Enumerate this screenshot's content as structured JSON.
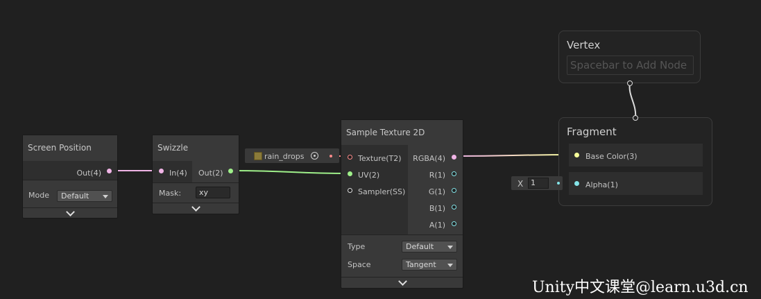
{
  "nodes": {
    "screen_position": {
      "title": "Screen Position",
      "out": "Out(4)",
      "mode_label": "Mode",
      "mode_value": "Default"
    },
    "swizzle": {
      "title": "Swizzle",
      "in": "In(4)",
      "out": "Out(2)",
      "mask_label": "Mask:",
      "mask_value": "xy"
    },
    "texture_property": {
      "value": "rain_drops"
    },
    "sample_texture": {
      "title": "Sample Texture 2D",
      "inputs": [
        "Texture(T2)",
        "UV(2)",
        "Sampler(SS)"
      ],
      "outputs": [
        "RGBA(4)",
        "R(1)",
        "G(1)",
        "B(1)",
        "A(1)"
      ],
      "type_label": "Type",
      "type_value": "Default",
      "space_label": "Space",
      "space_value": "Tangent"
    },
    "alpha_input": {
      "axis": "X",
      "value": "1"
    }
  },
  "master": {
    "vertex": {
      "title": "Vertex",
      "placeholder": "Spacebar to Add Node"
    },
    "fragment": {
      "title": "Fragment",
      "base_color": "Base Color(3)",
      "alpha": "Alpha(1)"
    }
  },
  "colors": {
    "vector4": "#f0b4e6",
    "vector2": "#9ff08a",
    "vector1": "#84e4e8",
    "vector3": "#f6ff9a",
    "texture": "#ff8b8b"
  },
  "watermark": "Unity中文课堂@learn.u3d.cn"
}
